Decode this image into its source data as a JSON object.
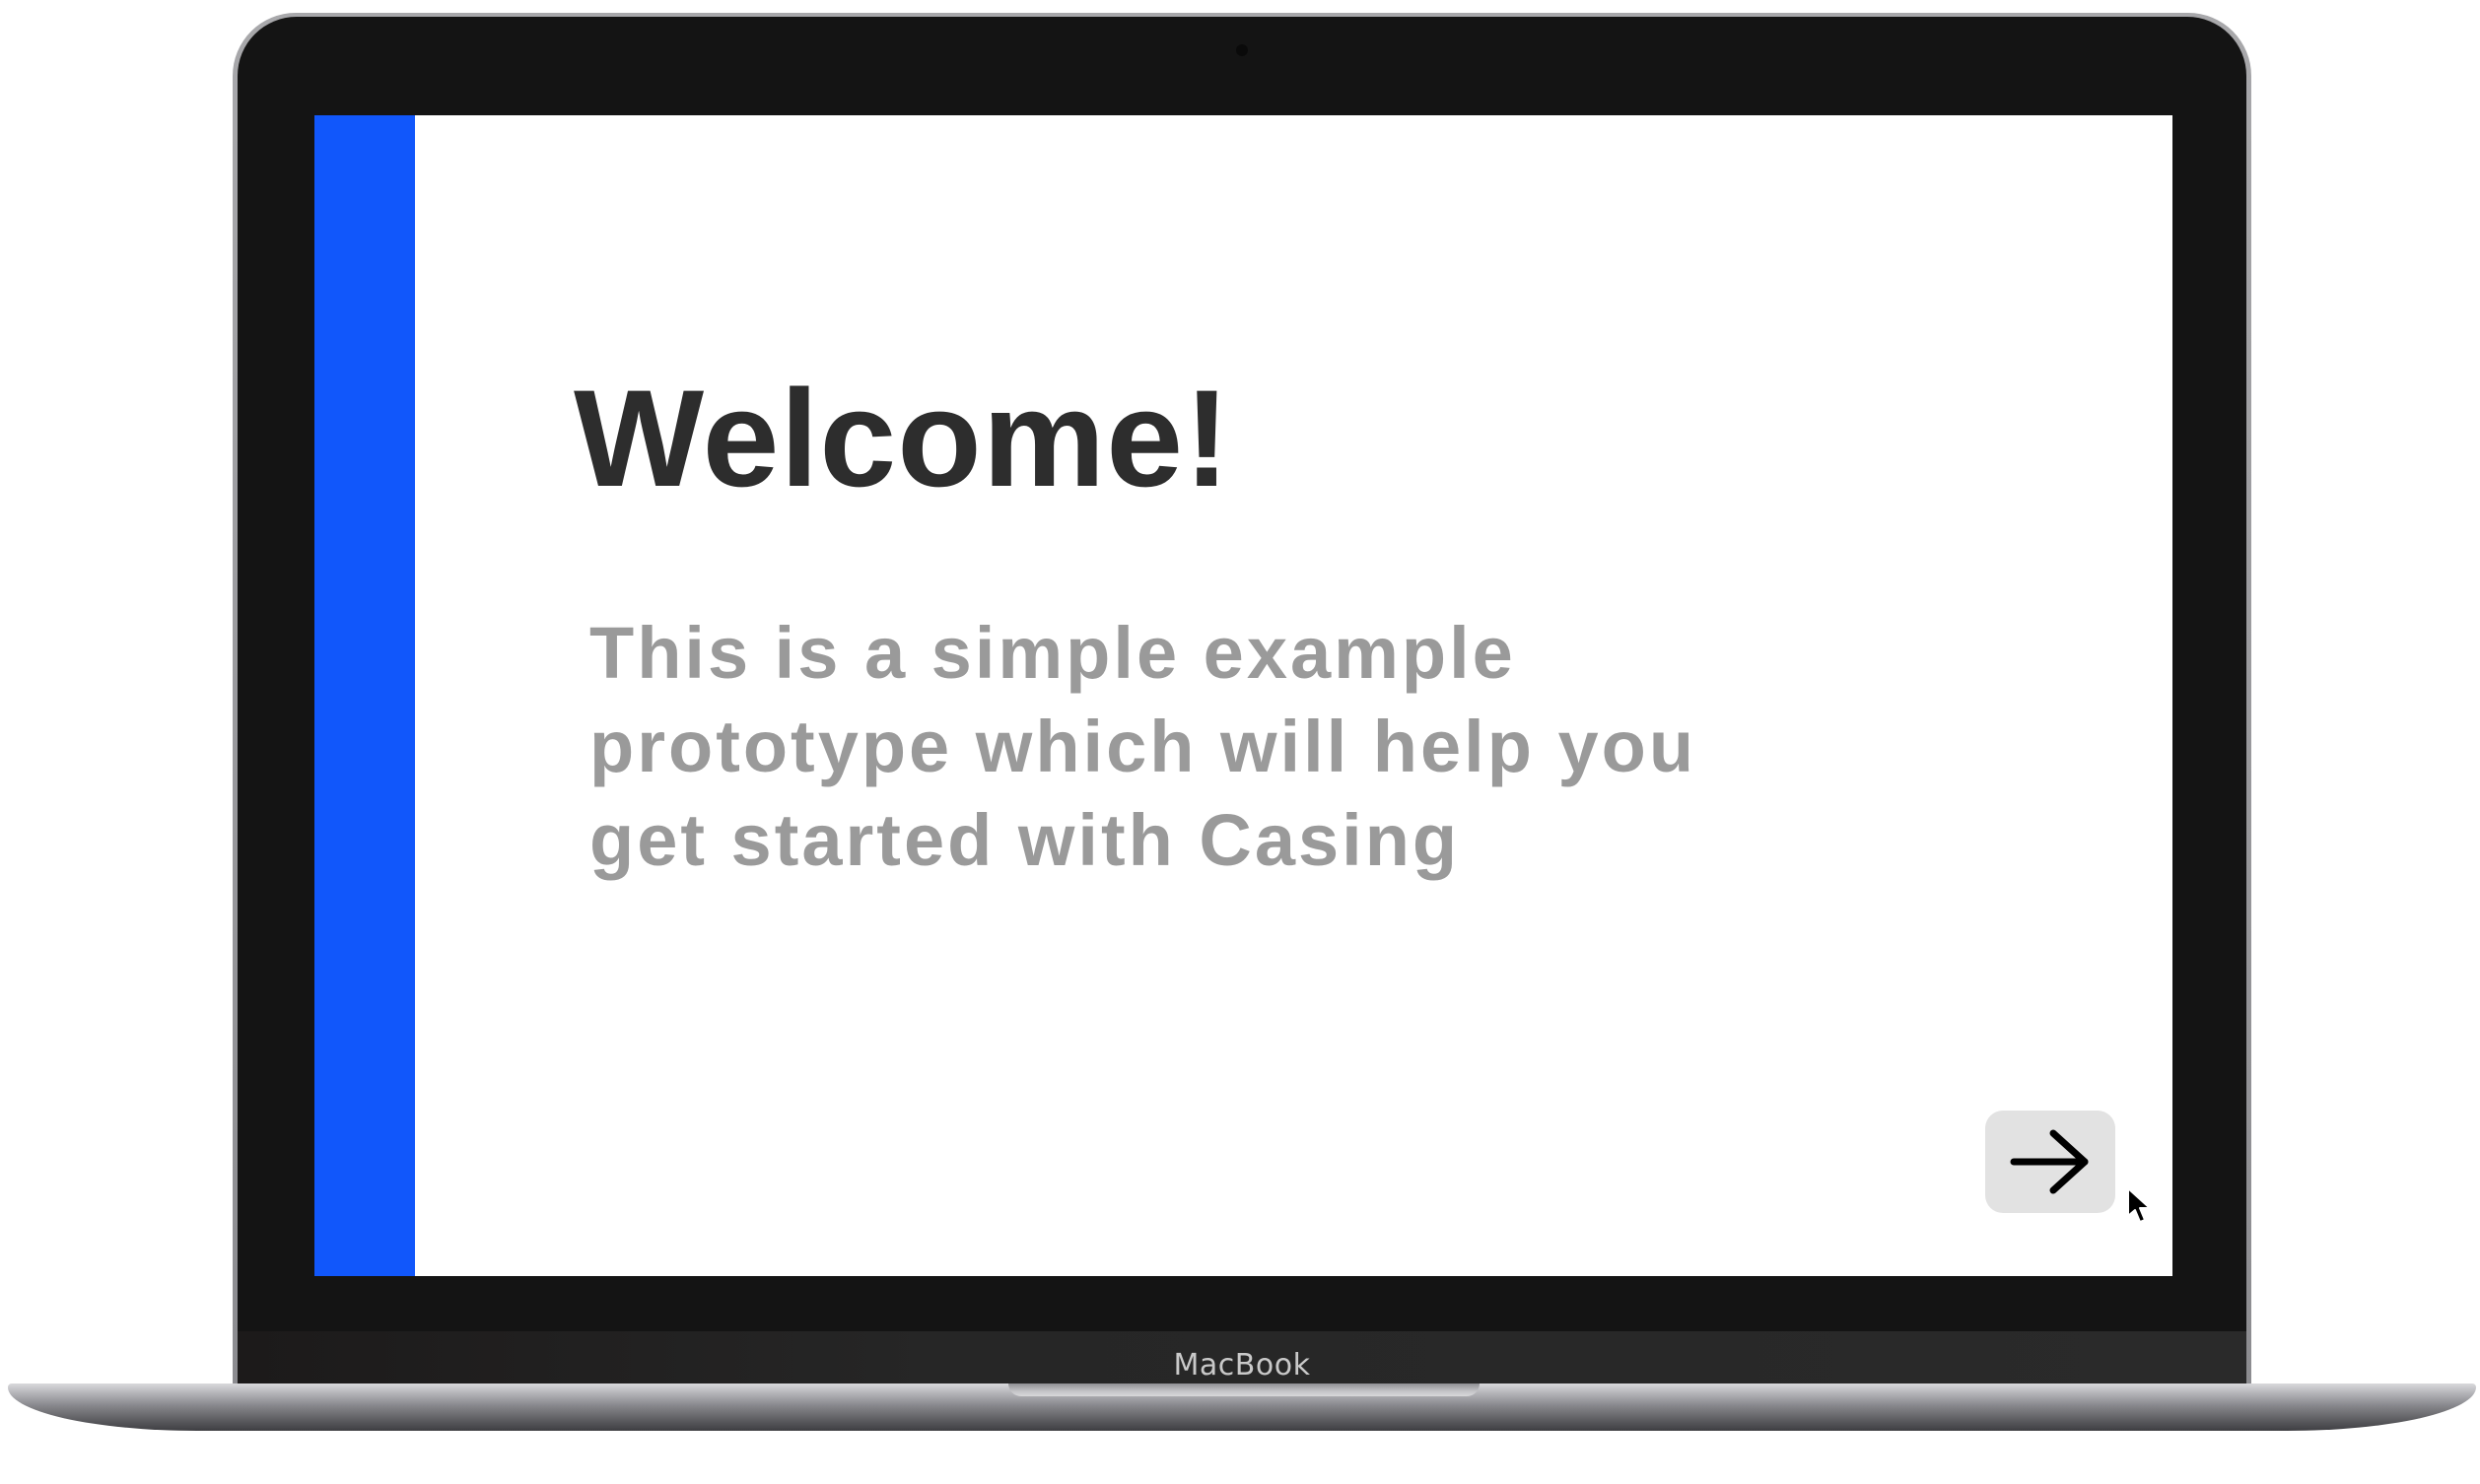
{
  "device": {
    "brand_label": "MacBook"
  },
  "screen": {
    "accent_color": "#1157fb",
    "title": "Welcome!",
    "body": "This is a simple example prototype which will help you get started with Casing",
    "next_button": {
      "icon": "arrow-right-icon"
    }
  }
}
